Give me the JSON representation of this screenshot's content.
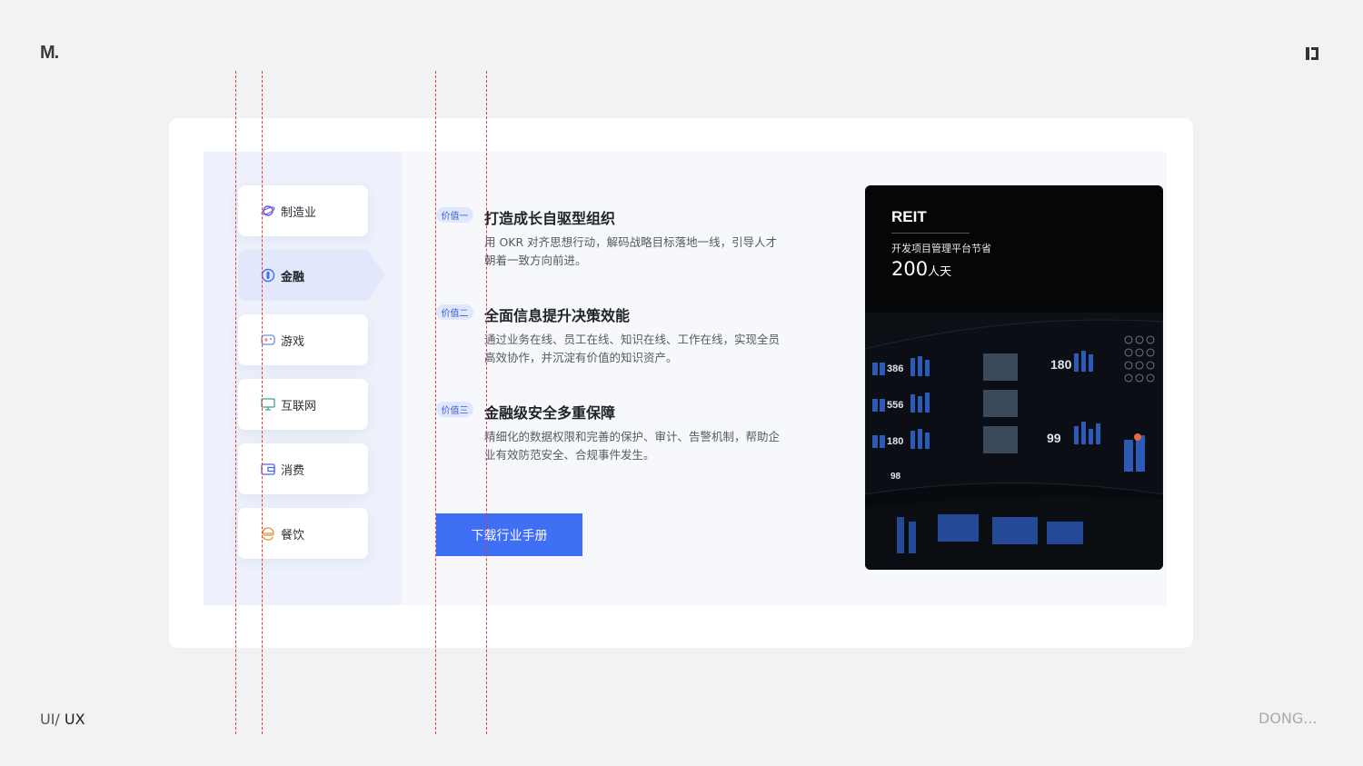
{
  "brand": {
    "logo": "M.",
    "footer_left_prefix": "UI/",
    "footer_left_suffix": "UX",
    "footer_right": "DONG..."
  },
  "sidebar": {
    "items": [
      {
        "label": "制造业",
        "icon": "planet-icon"
      },
      {
        "label": "金融",
        "icon": "coin-icon",
        "active": true
      },
      {
        "label": "游戏",
        "icon": "gamepad-icon"
      },
      {
        "label": "互联网",
        "icon": "monitor-icon"
      },
      {
        "label": "消费",
        "icon": "wallet-icon"
      },
      {
        "label": "餐饮",
        "icon": "food-icon"
      }
    ]
  },
  "values": [
    {
      "tag": "价值一",
      "title": "打造成长自驱型组织",
      "desc": "用 OKR 对齐思想行动，解码战略目标落地一线，引导人才朝着一致方向前进。"
    },
    {
      "tag": "价值二",
      "title": "全面信息提升决策效能",
      "desc": "通过业务在线、员工在线、知识在线、工作在线，实现全员高效协作，并沉淀有价值的知识资产。"
    },
    {
      "tag": "价值三",
      "title": "金融级安全多重保障",
      "desc": "精细化的数据权限和完善的保护、审计、告警机制，帮助企业有效防范安全、合规事件发生。"
    }
  ],
  "cta": {
    "label": "下载行业手册"
  },
  "case": {
    "brand": "REIT",
    "caption": "开发项目管理平台节省",
    "number": "200",
    "unit": "人天",
    "screen_numbers": [
      "386",
      "556",
      "180",
      "98",
      "180",
      "99"
    ]
  },
  "colors": {
    "accent": "#3e6ff5",
    "tag_bg": "#dfe7fc",
    "guide": "#e23b3b"
  }
}
